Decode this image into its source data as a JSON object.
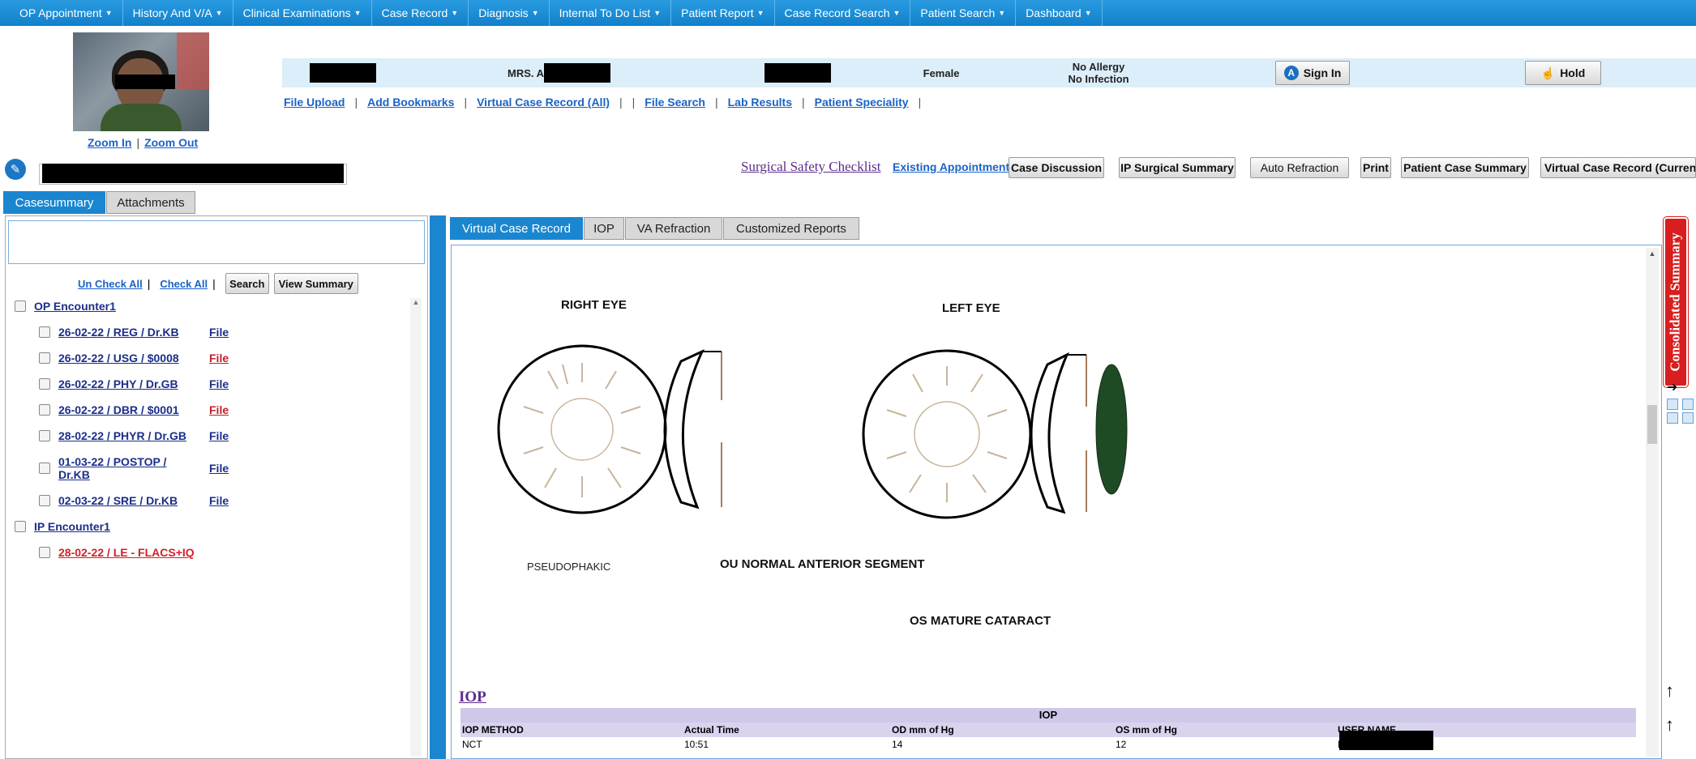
{
  "nav": {
    "items": [
      "OP Appointment",
      "History And V/A",
      "Clinical Examinations",
      "Case Record",
      "Diagnosis",
      "Internal To Do List",
      "Patient Report",
      "Case Record Search",
      "Patient Search",
      "Dashboard"
    ]
  },
  "patient": {
    "salutation": "MRS. A",
    "gender": "Female",
    "allergy": "No Allergy",
    "infection": "No Infection",
    "sign_in": "Sign In",
    "hold": "Hold"
  },
  "photo_links": {
    "zoom_in": "Zoom In",
    "sep": "|",
    "zoom_out": "Zoom Out"
  },
  "links": {
    "file_upload": "File Upload",
    "add_bookmarks": "Add Bookmarks",
    "virtual_case_record_all": "Virtual Case Record (All)",
    "file_search": "File Search",
    "lab_results": "Lab Results",
    "patient_speciality": "Patient Speciality",
    "sep": "|"
  },
  "actions": {
    "surgical_safety": "Surgical Safety Checklist",
    "existing_appointment": "Existing Appointment",
    "case_discussion": "Case Discussion",
    "ip_surgical_summary": "IP Surgical Summary",
    "auto_refraction": "Auto Refraction",
    "print": "Print",
    "patient_case_summary": "Patient Case Summary",
    "virtual_case_record_current": "Virtual Case Record (Current)"
  },
  "left_tabs": {
    "casesummary": "Casesummary",
    "attachments": "Attachments"
  },
  "left_controls": {
    "uncheck_all": "Un Check All",
    "check_all": "Check All",
    "sep": "|",
    "search": "Search",
    "view_summary": "View Summary"
  },
  "encounters": {
    "op_title": "OP Encounter1",
    "op_items": [
      {
        "label": "26-02-22 / REG / Dr.KB",
        "file": "File"
      },
      {
        "label": "26-02-22 / USG / $0008",
        "file": "File"
      },
      {
        "label": "26-02-22 / PHY / Dr.GB",
        "file": "File"
      },
      {
        "label": "26-02-22 / DBR / $0001",
        "file": "File"
      },
      {
        "label": "28-02-22 / PHYR / Dr.GB",
        "file": "File"
      },
      {
        "label": "01-03-22 / POSTOP / Dr.KB",
        "file": "File"
      },
      {
        "label": "02-03-22 / SRE / Dr.KB",
        "file": "File"
      }
    ],
    "ip_title": "IP Encounter1",
    "ip_items": [
      {
        "label": "28-02-22 / LE - FLACS+IQ"
      }
    ]
  },
  "right_tabs": {
    "virtual_case_record": "Virtual Case Record",
    "iop": "IOP",
    "va_refraction": "VA Refraction",
    "customized_reports": "Customized Reports"
  },
  "record": {
    "right_eye": "RIGHT EYE",
    "left_eye": "LEFT EYE",
    "pseudophakic": "PSEUDOPHAKIC",
    "ou_normal": "OU NORMAL ANTERIOR SEGMENT",
    "os_mature": "OS MATURE CATARACT",
    "iop_link": "IOP"
  },
  "iop_table": {
    "title": "IOP",
    "headers": [
      "IOP METHOD",
      "Actual Time",
      "OD mm of Hg",
      "OS mm of Hg",
      "USER NAME"
    ],
    "rows": [
      [
        "NCT",
        "10:51",
        "14",
        "12",
        "L"
      ]
    ]
  },
  "consolidated": "Consolidated Summary",
  "colors": {
    "accent": "#1a86d0",
    "cataract": "#1e4a24",
    "alert": "#d81e1e"
  }
}
